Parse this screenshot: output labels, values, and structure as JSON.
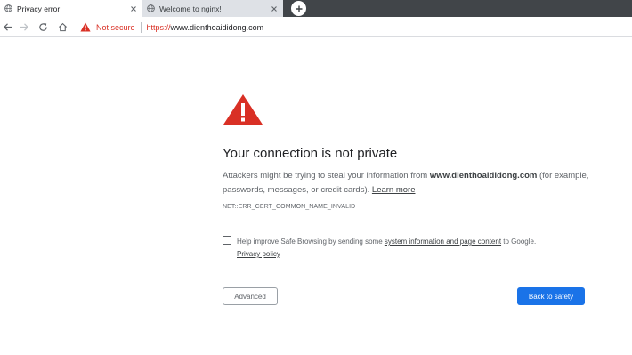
{
  "tabs": [
    {
      "title": "Privacy error",
      "icon": "globe-icon",
      "active": true
    },
    {
      "title": "Welcome to nginx!",
      "icon": "globe-icon",
      "active": false
    }
  ],
  "toolbar": {
    "security_label": "Not secure",
    "url_scheme": "https://",
    "url_host": "www.dienthoaididong.com"
  },
  "interstitial": {
    "heading": "Your connection is not private",
    "desc_prefix": "Attackers might be trying to steal your information from ",
    "desc_host": "www.dienthoaididong.com",
    "desc_suffix": " (for example, passwords, messages, or credit cards). ",
    "learn_more": "Learn more",
    "error_code": "NET::ERR_CERT_COMMON_NAME_INVALID",
    "safe_browsing_prefix": "Help improve Safe Browsing by sending some ",
    "safe_browsing_link": "system information and page content",
    "safe_browsing_suffix": " to Google.",
    "privacy_policy": "Privacy policy",
    "safe_browsing_checked": false,
    "advanced_button": "Advanced",
    "back_button": "Back to safety"
  },
  "colors": {
    "warning_red": "#d93025",
    "primary_blue": "#1a73e8",
    "tabstrip_bg": "#414549"
  }
}
